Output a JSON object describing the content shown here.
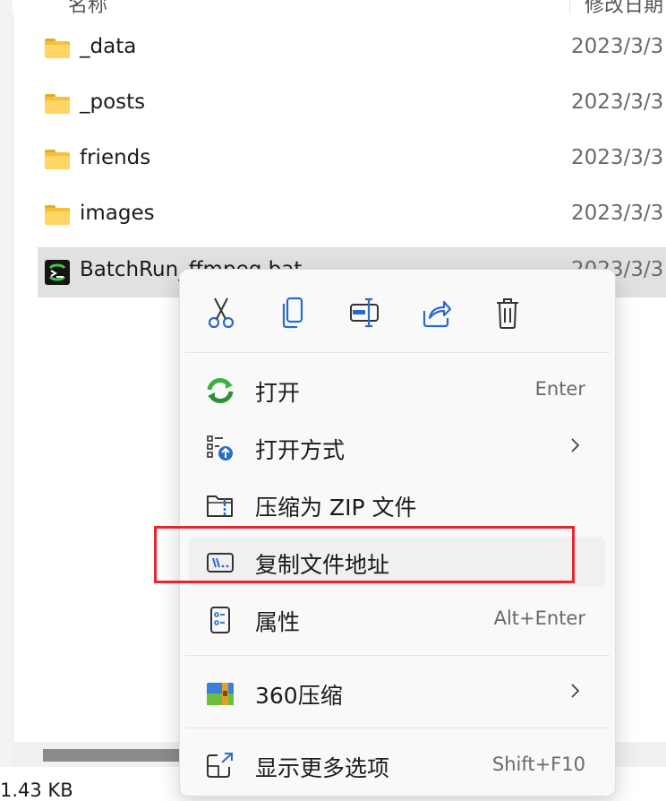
{
  "header": {
    "name_col": "名称",
    "date_col": "修改日期"
  },
  "files": [
    {
      "name": "_data",
      "date": "2023/3/3",
      "type": "folder"
    },
    {
      "name": "_posts",
      "date": "2023/3/3",
      "type": "folder"
    },
    {
      "name": "friends",
      "date": "2023/3/3",
      "type": "folder"
    },
    {
      "name": "images",
      "date": "2023/3/3",
      "type": "folder"
    },
    {
      "name": "BatchRun_ffmpeg.bat",
      "date": "2023/3/3",
      "type": "batch",
      "selected": true
    }
  ],
  "status": {
    "size": "1.43 KB"
  },
  "context_menu": {
    "quick_actions": [
      "cut-icon",
      "copy-icon",
      "rename-icon",
      "share-icon",
      "delete-icon"
    ],
    "items": [
      {
        "label": "打开",
        "shortcut": "Enter",
        "icon": "open-refresh-icon"
      },
      {
        "label": "打开方式",
        "submenu": true,
        "icon": "open-with-icon"
      },
      {
        "label": "压缩为 ZIP 文件",
        "icon": "zip-folder-icon"
      },
      {
        "label": "复制文件地址",
        "icon": "copy-path-icon",
        "highlighted": true
      },
      {
        "label": "属性",
        "shortcut": "Alt+Enter",
        "icon": "properties-icon"
      },
      {
        "label": "360压缩",
        "submenu": true,
        "icon": "zip-360-icon"
      },
      {
        "label": "显示更多选项",
        "shortcut": "Shift+F10",
        "icon": "more-options-icon"
      }
    ]
  },
  "colors": {
    "accent": "#0067c0",
    "highlight_box": "#e8242e",
    "folder": "#f5c13b"
  }
}
